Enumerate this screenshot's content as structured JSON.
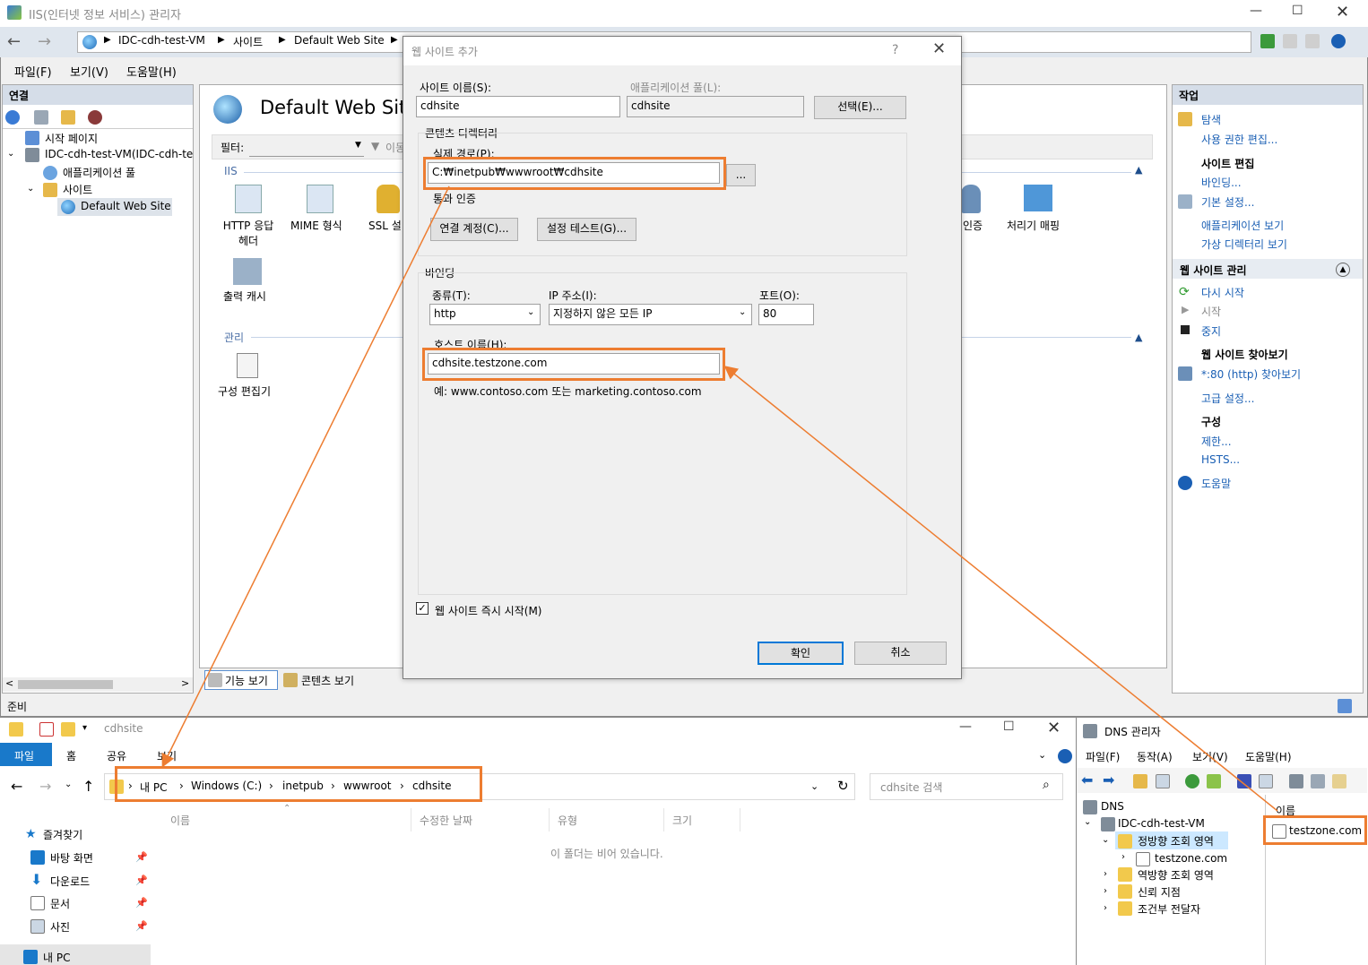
{
  "iis": {
    "title": "IIS(인터넷 정보 서비스) 관리자",
    "breadcrumb": [
      "IDC-cdh-test-VM",
      "사이트",
      "Default Web Site"
    ],
    "menu": [
      "파일(F)",
      "보기(V)",
      "도움말(H)"
    ],
    "connections_title": "연결",
    "tree": {
      "start": "시작 페이지",
      "server": "IDC-cdh-test-VM(IDC-cdh-te",
      "pools": "애플리케이션 풀",
      "sites": "사이트",
      "dws": "Default Web Site"
    },
    "main_title": "Default Web Site",
    "filter_label": "필터:",
    "filter_go": "이동",
    "iis_section": "IIS",
    "manage_section": "관리",
    "features": {
      "http": "HTTP 응답\n헤더",
      "mime": "MIME 형식",
      "ssl": "SSL 설",
      "auth": "인증",
      "handler": "처리기 매핑",
      "cache": "출력 캐시",
      "config": "구성 편집기"
    },
    "view_tabs": [
      "기능 보기",
      "콘텐츠 보기"
    ],
    "status": "준비",
    "actions": {
      "title": "작업",
      "explore": "탐색",
      "perm": "사용 권한 편집...",
      "edit_site": "사이트 편집",
      "bindings": "바인딩...",
      "basic": "기본 설정...",
      "view_apps": "애플리케이션 보기",
      "view_vdirs": "가상 디렉터리 보기",
      "manage": "웹 사이트 관리",
      "restart": "다시 시작",
      "start": "시작",
      "stop": "중지",
      "browse": "웹 사이트 찾아보기",
      "browse80": "*:80 (http) 찾아보기",
      "advanced": "고급 설정...",
      "config": "구성",
      "limits": "제한...",
      "hsts": "HSTS...",
      "help": "도움말"
    }
  },
  "dialog": {
    "title": "웹 사이트 추가",
    "help": "?",
    "site_name_label": "사이트 이름(S):",
    "site_name": "cdhsite",
    "pool_label": "애플리케이션 풀(L):",
    "pool": "cdhsite",
    "select_btn": "선택(E)...",
    "content_dir": "콘텐츠 디렉터리",
    "path_label": "실제 경로(P):",
    "path": "C:₩inetpub₩wwwroot₩cdhsite",
    "browse_btn": "...",
    "passthrough": "통과 인증",
    "connect_as": "연결 계정(C)...",
    "test_settings": "설정 테스트(G)...",
    "binding": "바인딩",
    "type_label": "종류(T):",
    "type": "http",
    "ip_label": "IP 주소(I):",
    "ip": "지정하지 않은 모든 IP",
    "port_label": "포트(O):",
    "port": "80",
    "host_label": "호스트 이름(H):",
    "host": "cdhsite.testzone.com",
    "example": "예: www.contoso.com 또는 marketing.contoso.com",
    "start_now": "웹 사이트 즉시 시작(M)",
    "ok": "확인",
    "cancel": "취소"
  },
  "explorer": {
    "title": "cdhsite",
    "ribbon": [
      "파일",
      "홈",
      "공유",
      "보기"
    ],
    "path": [
      "내 PC",
      "Windows (C:)",
      "inetpub",
      "wwwroot",
      "cdhsite"
    ],
    "search_placeholder": "cdhsite 검색",
    "quick_access": "즐겨찾기",
    "nav": [
      "바탕 화면",
      "다운로드",
      "문서",
      "사진"
    ],
    "this_pc": "내 PC",
    "columns": [
      "이름",
      "수정한 날짜",
      "유형",
      "크기"
    ],
    "empty": "이 폴더는 비어 있습니다."
  },
  "dns": {
    "title": "DNS 관리자",
    "menu": [
      "파일(F)",
      "동작(A)",
      "보기(V)",
      "도움말(H)"
    ],
    "tree": {
      "root": "DNS",
      "server": "IDC-cdh-test-VM",
      "forward": "정방향 조회 영역",
      "zone": "testzone.com",
      "reverse": "역방향 조회 영역",
      "trust": "신뢰 지점",
      "cond": "조건부 전달자"
    },
    "col_name": "이름",
    "item": "testzone.com"
  },
  "colors": {
    "accent": "#ed7d31",
    "blue": "#1a5fb4",
    "selection": "#cce8ff"
  }
}
